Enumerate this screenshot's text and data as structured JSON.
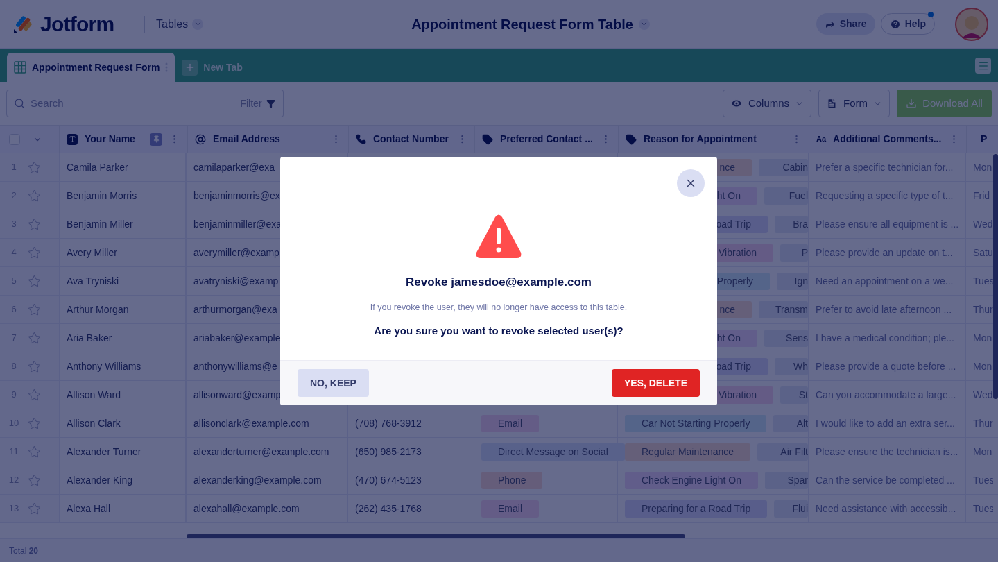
{
  "header": {
    "logo": "Jotform",
    "product": "Tables",
    "title": "Appointment Request Form Table",
    "share": "Share",
    "help": "Help",
    "help_notification": true
  },
  "tabs": [
    {
      "label": "Appointment Request Form",
      "selected": true
    }
  ],
  "new_tab": "New Tab",
  "toolbar": {
    "search_placeholder": "Search",
    "filter": "Filter",
    "columns": "Columns",
    "form": "Form",
    "download": "Download All"
  },
  "table": {
    "select_all": false,
    "columns": [
      {
        "label": "Your Name",
        "kind": "text",
        "pinned": true
      },
      {
        "label": "Email Address",
        "kind": "email"
      },
      {
        "label": "Contact Number",
        "kind": "phone"
      },
      {
        "label": "Preferred Contact ...",
        "kind": "tag"
      },
      {
        "label": "Reason for Appointment",
        "kind": "tag"
      },
      {
        "label": "Additional Comments...",
        "kind": "longtext",
        "icon_text": "Aa"
      },
      {
        "label": "P",
        "kind": "date"
      }
    ],
    "rows": [
      {
        "number": "1",
        "starred": false,
        "name": "Camila Parker",
        "email": "camilaparker@exa",
        "reason": [
          {
            "label": "nce",
            "color": "#655f79"
          },
          {
            "label": "Cabin",
            "color": "#5b6288"
          }
        ],
        "comment": "Prefer a specific technician for...",
        "day": "Mon"
      },
      {
        "number": "2",
        "starred": false,
        "name": "Benjamin Morris",
        "email": "benjaminmorris@ex",
        "reason": [
          {
            "label": "ht On",
            "color": "#615d8a"
          },
          {
            "label": "Fuel",
            "color": "#5b6288"
          }
        ],
        "comment": "Requesting a specific type of t...",
        "day": "Frid"
      },
      {
        "number": "3",
        "starred": false,
        "name": "Benjamin Miller",
        "email": "benjaminmiller@exa",
        "reason": [
          {
            "label": "oad Trip",
            "color": "#585d8a"
          },
          {
            "label": "Bra",
            "color": "#5b6288"
          }
        ],
        "comment": "Please ensure all equipment is ...",
        "day": "Wed"
      },
      {
        "number": "4",
        "starred": false,
        "name": "Avery Miller",
        "email": "averymiller@examp",
        "reason": [
          {
            "label": "Vibration",
            "color": "#645b85"
          },
          {
            "label": "P",
            "color": "#5b6288"
          }
        ],
        "comment": "Please provide an update on t...",
        "day": "Satu"
      },
      {
        "number": "5",
        "starred": false,
        "name": "Ava Tryniski",
        "email": "avatryniski@examp",
        "reason": [
          {
            "label": "Properly",
            "color": "#546489"
          },
          {
            "label": "Ign",
            "color": "#5b6288"
          }
        ],
        "comment": "Need an appointment on a we...",
        "day": "Tues"
      },
      {
        "number": "6",
        "starred": false,
        "name": "Arthur Morgan",
        "email": "arthurmorgan@exa",
        "reason": [
          {
            "label": "nce",
            "color": "#655f79"
          },
          {
            "label": "Transm",
            "color": "#5b6288"
          }
        ],
        "comment": "Prefer to avoid late afternoon ...",
        "day": "Thur"
      },
      {
        "number": "7",
        "starred": false,
        "name": "Aria Baker",
        "email": "ariabaker@example",
        "reason": [
          {
            "label": "ht On",
            "color": "#615d8a"
          },
          {
            "label": "Sens",
            "color": "#5b6288"
          }
        ],
        "comment": "I have a medical condition; ple...",
        "day": "Mon"
      },
      {
        "number": "8",
        "starred": false,
        "name": "Anthony Williams",
        "email": "anthonywilliams@e",
        "reason": [
          {
            "label": "oad Trip",
            "color": "#585d8a"
          },
          {
            "label": "Wh",
            "color": "#5b6288"
          }
        ],
        "comment": "Please provide a quote before ...",
        "day": "Mon"
      },
      {
        "number": "9",
        "starred": false,
        "name": "Allison Ward",
        "email": "allisonward@examp",
        "reason": [
          {
            "label": "Vibration",
            "color": "#645b85"
          },
          {
            "label": "St",
            "color": "#5b6288"
          }
        ],
        "comment": "Can you accommodate a large...",
        "day": "Wed"
      },
      {
        "number": "10",
        "starred": false,
        "name": "Allison Clark",
        "email": "allisonclark@example.com",
        "phone": "(708) 768-3912",
        "contact": {
          "label": "Email",
          "color": "#645c86"
        },
        "reason": [
          {
            "label": "Car Not Starting Properly",
            "color": "#546489"
          },
          {
            "label": "Alt",
            "color": "#5b6288"
          }
        ],
        "comment": "I would like to add an extra ser...",
        "day": "Thur"
      },
      {
        "number": "11",
        "starred": false,
        "name": "Alexander Turner",
        "email": "alexanderturner@example.com",
        "phone": "(650) 985-2173",
        "contact": {
          "label": "Direct Message on Social",
          "color": "#58618a"
        },
        "reason": [
          {
            "label": "Regular Maintenance",
            "color": "#655f79"
          },
          {
            "label": "Air Filt",
            "color": "#5b6288"
          }
        ],
        "comment": "Please ensure the technician is...",
        "day": "Mon"
      },
      {
        "number": "12",
        "starred": false,
        "name": "Alexander King",
        "email": "alexanderking@example.com",
        "phone": "(470) 674-5123",
        "contact": {
          "label": "Phone",
          "color": "#655d7a"
        },
        "reason": [
          {
            "label": "Check Engine Light On",
            "color": "#615d8a"
          },
          {
            "label": "Spar",
            "color": "#5b6288"
          }
        ],
        "comment": "Can the service be completed ...",
        "day": "Tues"
      },
      {
        "number": "13",
        "starred": false,
        "name": "Alexa Hall",
        "email": "alexahall@example.com",
        "phone": "(262) 435-1768",
        "contact": {
          "label": "Email",
          "color": "#645c86"
        },
        "reason": [
          {
            "label": "Preparing for a Road Trip",
            "color": "#585d8a"
          },
          {
            "label": "Flui",
            "color": "#5b6288"
          }
        ],
        "comment": "Need assistance with accessib...",
        "day": "Tues"
      }
    ]
  },
  "footer": "Total **20**",
  "dialog": {
    "title": "Revoke jamesdoe@example.com",
    "message": "If you revoke the user, they will no longer have access to this table.",
    "question": "Are you sure you want to revoke selected user(s)?",
    "cancel": "NO, KEEP",
    "confirm": "YES, DELETE"
  }
}
